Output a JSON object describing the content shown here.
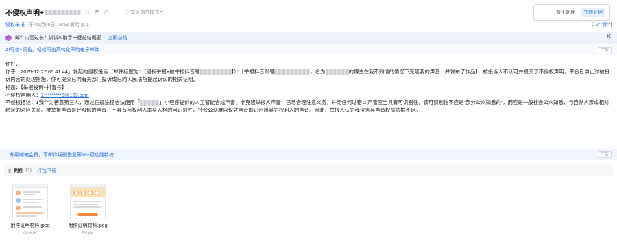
{
  "header": {
    "subject": "不侵权声明+",
    "safe_mode": "安全浏览模式",
    "sender_label": "侵权举报",
    "sent_time": "于 01月05日 19:53 发给",
    "recipient_count": "1",
    "actions": {
      "not_handle": "暂不处理",
      "handle_now": "立即处理"
    },
    "attachment_count": "2个附件"
  },
  "ai_banner": {
    "prompt": "邮件内容过长？试试AI助手一键总结概要",
    "summary_link": "立即总结",
    "close_icon": "close-icon"
  },
  "promo": {
    "text": "AI写信+润色，轻松写出高转化率的电子邮件",
    "ad_tag": "广告"
  },
  "body": {
    "greeting": "你好，",
    "p1_a": "你于「2025-12-27 05:41:44」发起的侵权投诉（邮件标题为：【侵权举报+被举报抖音号",
    "p1_b": "】）：【举报抖音账号",
    "p1_c": "，名为",
    "p1_d": "的博主在我不知情的情况下克隆我的声音，并发布了作品】，被投诉人不认可并提交了不侵权声明，平台已中止对被投诉内容的处理措施，你可提交已向有关部门投诉或已向人民法院提起诉讼的相关证明。",
    "title_line": "标题：【举报投诉+抖音号】",
    "declarant_label": "不侵权声明人：",
    "declarant_email": "1*********3@163.com",
    "desc_label": "不侵权描述：",
    "desc_a": "1我作为善意第三人，通过正规途径合法使用「",
    "desc_b": "」小程序提供的人工智能合成声音，非克隆举报人声音，已尽合理注意义务，并无任何过错 2.声音应当具有可识别性，该可识别性不应是“部分公众知悉的”，而应是一般社会公众知悉、与自然人形成相对稳定的对应关系。被举报声音是经AI化的声音，不具有与权利人本身人格的可识别性，社会公众难以仅凭声音即识别出其为权利人的声音。因此，举报人认为我侵害其声音权益依据不足。"
  },
  "vip_bar": {
    "text": "升级邮箱会员，享邮件误删恢复等10+项功能特权!",
    "ad_tag": "广告"
  },
  "attachments": {
    "title": "附件",
    "count": "(2)",
    "download_label": "打包下载",
    "items": [
      {
        "name": "附件证明材料.jpeg",
        "size": "98.61K"
      },
      {
        "name": "附件证明材料.jpeg",
        "size": "59.4K"
      }
    ]
  },
  "colors": {
    "accent": "#1f6fd6",
    "banner_bg": "#eef2fb",
    "vip_bg": "#f1f5fc"
  }
}
